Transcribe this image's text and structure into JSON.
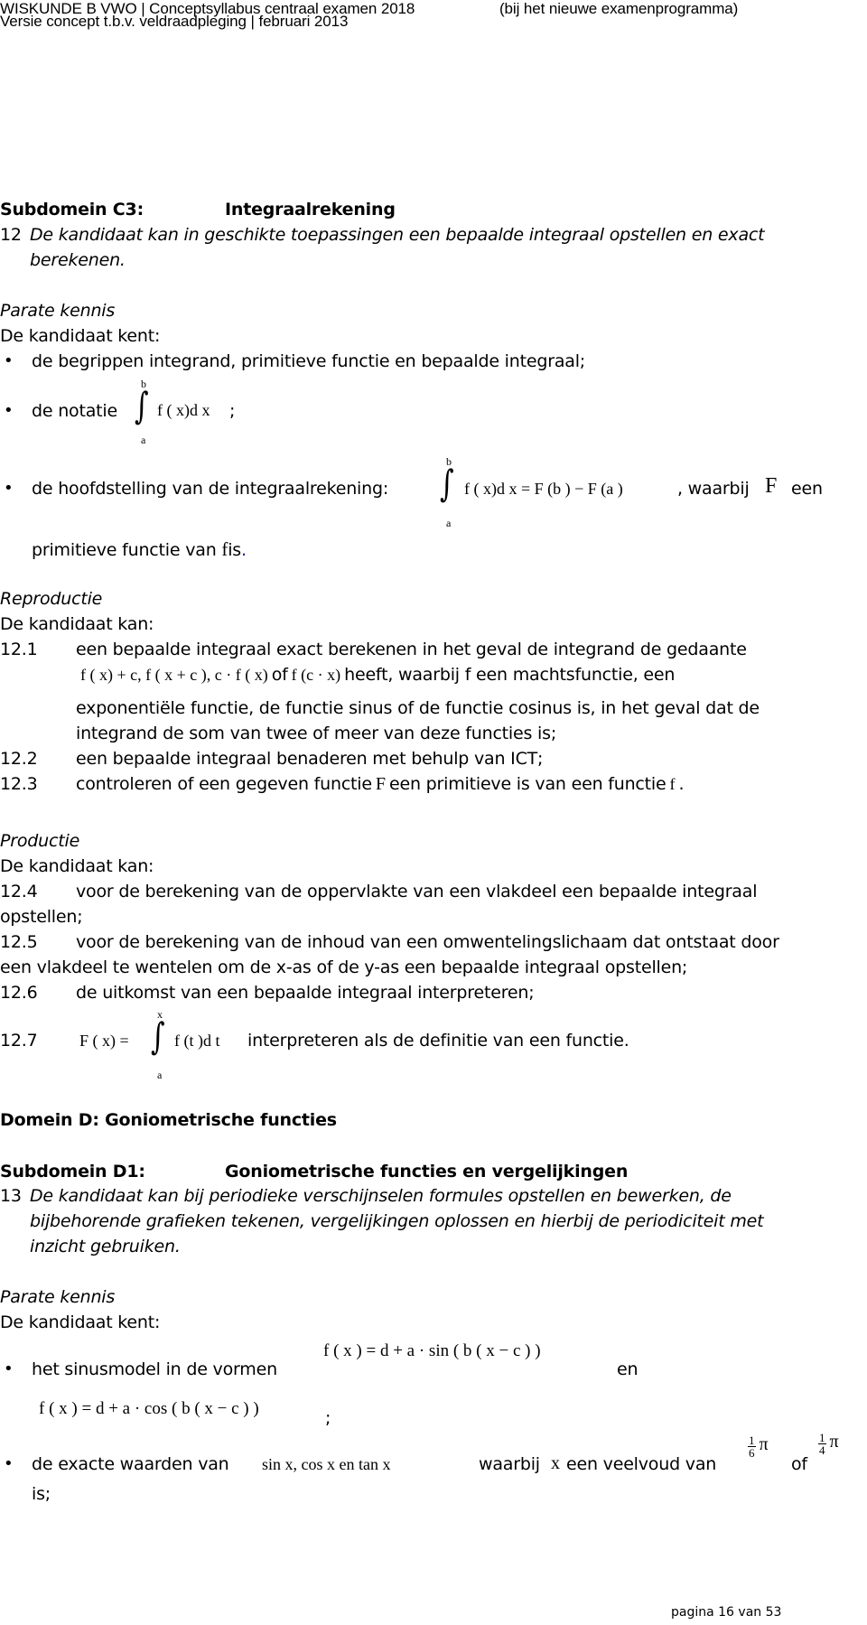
{
  "header": {
    "line1": "WISKUNDE B VWO | Conceptsyllabus centraal examen 2018",
    "line1_right": "(bij het nieuwe examenprogramma)",
    "line2": "Versie concept t.b.v. veldraadpleging | februari 2013"
  },
  "c3": {
    "subdomain_label": "Subdomein C3:",
    "subdomain_title": "Integraalrekening",
    "goal_number": "12",
    "goal_line1": "De kandidaat kan in geschikte toepassingen een bepaalde integraal opstellen en exact",
    "goal_line2": "berekenen.",
    "parate": {
      "heading": "Parate kennis",
      "intro": "De kandidaat kent:",
      "bullet1": "de begrippen integrand, primitieve functie en bepaalde integraal;",
      "bullet2_text": "de notatie",
      "bullet2_formula": "f ( x)d x",
      "bullet2_end": ";",
      "bullet2_upper": "b",
      "bullet2_lower": "a",
      "bullet3_text": "de hoofdstelling van de integraalrekening:",
      "bullet3_formula": "f ( x)d x  =  F (b )  −  F (a )",
      "bullet3_upper": "b",
      "bullet3_lower": "a",
      "bullet3_after": ", waarbij",
      "bullet3_F": "F",
      "bullet3_een": "een",
      "bullet3_line2a": "primitieve functie van",
      "bullet3_f": "f",
      "bullet3_line2b": "is",
      "bullet3_period": ".",
      "bullet_glyph": "•"
    },
    "reproductie": {
      "heading": "Reproductie",
      "intro": "De kandidaat kan:",
      "items": [
        {
          "num": "12.1",
          "line1": "een bepaalde integraal exact berekenen in het geval de integrand de gedaante",
          "formula1": "f ( x) + c,  f ( x + c ), c · f ( x)",
          "of": "of",
          "formula2": "f (c · x)",
          "line2_rest": "heeft, waarbij f een machtsfunctie, een",
          "line3": "exponentiële functie, de functie sinus of de functie cosinus is, in het geval dat de",
          "line4": "integrand de som van twee of meer van deze functies is;"
        },
        {
          "num": "12.2",
          "text": "een bepaalde integraal benaderen met behulp van ICT;"
        },
        {
          "num": "12.3",
          "text_a": "controleren of een gegeven functie",
          "F": "F",
          "text_b": "een primitieve is van een functie",
          "f": "f",
          "end": "."
        }
      ]
    },
    "productie": {
      "heading": "Productie",
      "intro": "De kandidaat kan:",
      "items": [
        {
          "num": "12.4",
          "line1": "voor de berekening van de oppervlakte van een vlakdeel een bepaalde integraal",
          "line2": "opstellen;"
        },
        {
          "num": "12.5",
          "line1": "voor de berekening van de inhoud van een omwentelingslichaam dat ontstaat door",
          "line2": "een vlakdeel te wentelen om de x-as of de y-as een bepaalde integraal opstellen;"
        },
        {
          "num": "12.6",
          "text": "de uitkomst van een bepaalde integraal interpreteren;"
        },
        {
          "num": "12.7",
          "formula_left": "F ( x) =",
          "formula_right": "f (t )d t",
          "upper": "x",
          "lower": "a",
          "text": "interpreteren als de definitie van een functie."
        }
      ]
    }
  },
  "d": {
    "domain_title": "Domein D: Goniometrische functies",
    "subdomain_label": "Subdomein D1:",
    "subdomain_title": "Goniometrische functies en vergelijkingen",
    "goal_number": "13",
    "goal_line1": "De kandidaat kan bij periodieke verschijnselen formules opstellen en bewerken, de",
    "goal_line2": "bijbehorende grafieken tekenen, vergelijkingen oplossen en hierbij de periodiciteit met",
    "goal_line3": "inzicht gebruiken.",
    "parate": {
      "heading": "Parate kennis",
      "intro": "De kandidaat kent:",
      "bullet1_text": "het sinusmodel in de vormen",
      "sin_formula": "f ( x ) = d + a · sin ( b ( x  −  c ) )",
      "en": "en",
      "cos_formula": "f ( x ) = d + a · cos ( b ( x  −  c ) )",
      "cos_end": ";",
      "bullet2_text": "de exacte waarden van",
      "bullet2_formula": "sin x,   cos x en   tan x",
      "bullet2_waarbij": "waarbij",
      "bullet2_x": "x",
      "bullet2_rest": "een veelvoud van",
      "frac1_num": "1",
      "frac1_den": "6",
      "pi": "π",
      "of": "of",
      "frac2_num": "1",
      "frac2_den": "4",
      "bullet2_line2": "is;"
    }
  },
  "footer": {
    "page": "pagina 16 van 53"
  }
}
